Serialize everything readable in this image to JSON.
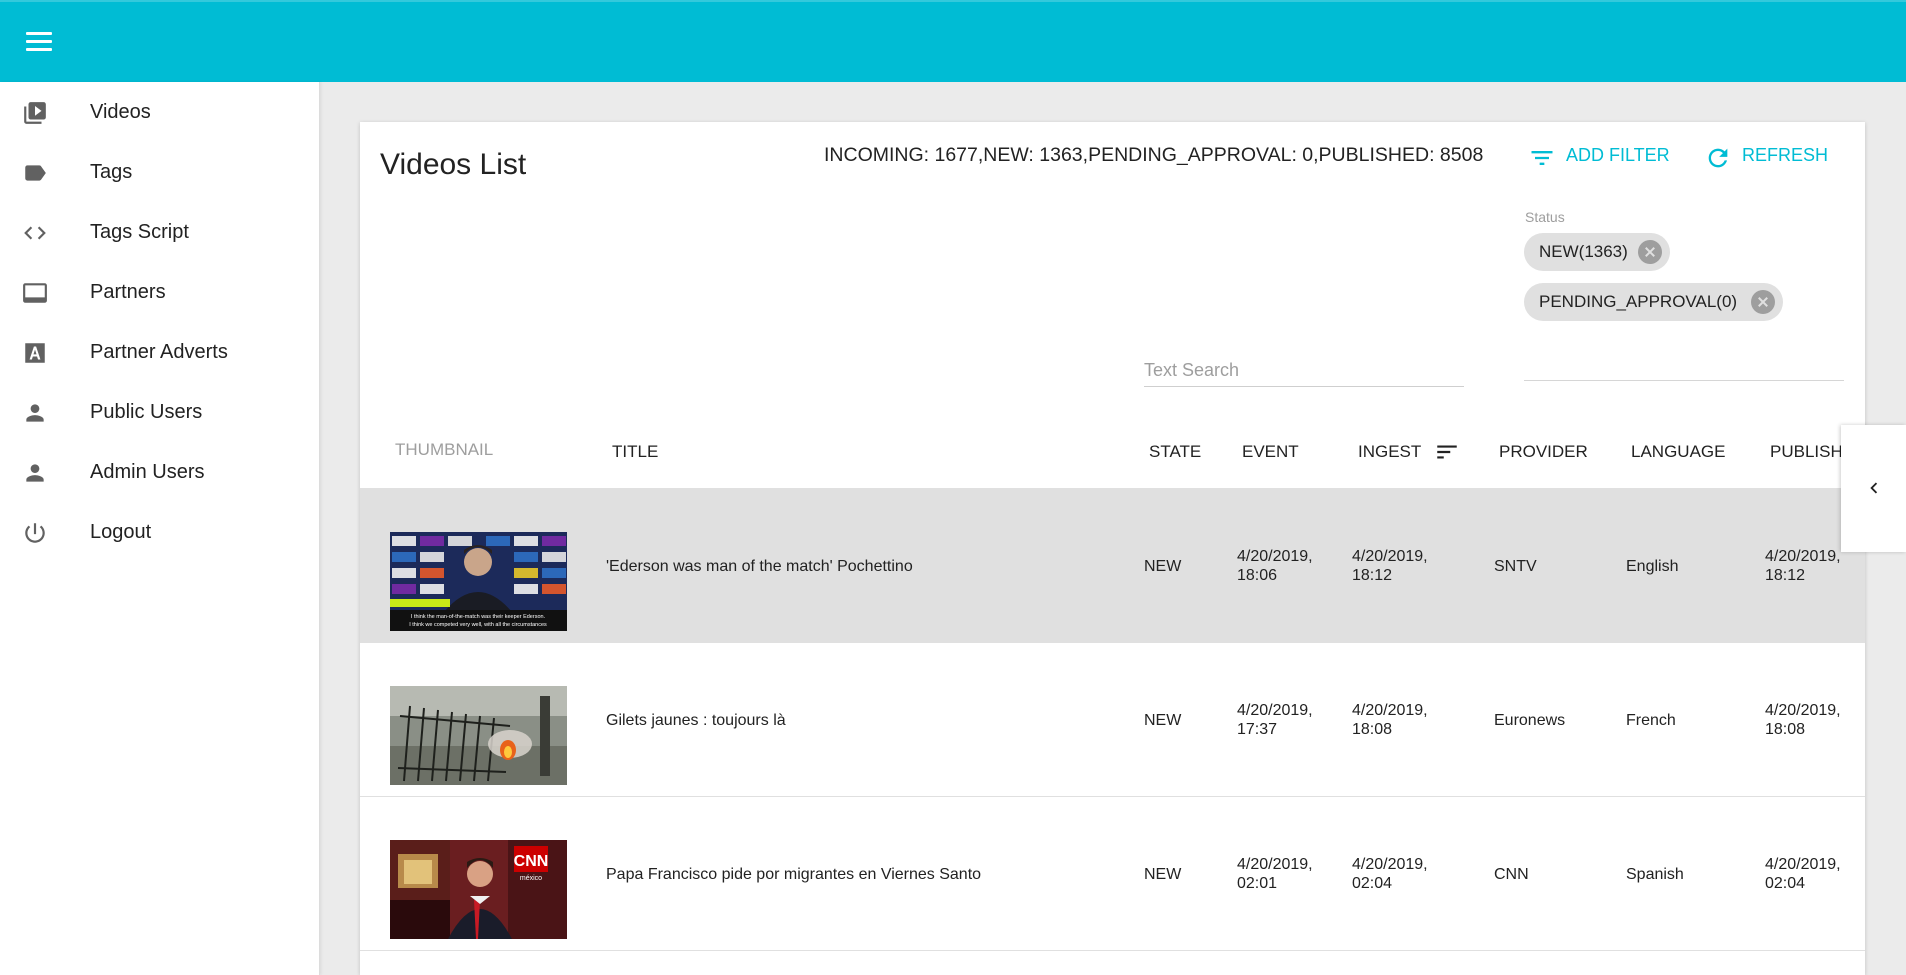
{
  "sidebar": {
    "items": [
      {
        "label": "Videos",
        "icon": "video-library-icon"
      },
      {
        "label": "Tags",
        "icon": "tag-icon"
      },
      {
        "label": "Tags Script",
        "icon": "code-icon"
      },
      {
        "label": "Partners",
        "icon": "monitor-icon"
      },
      {
        "label": "Partner Adverts",
        "icon": "letter-a-icon"
      },
      {
        "label": "Public Users",
        "icon": "person-icon"
      },
      {
        "label": "Admin Users",
        "icon": "person-icon"
      },
      {
        "label": "Logout",
        "icon": "power-icon"
      }
    ]
  },
  "main": {
    "title": "Videos List",
    "counts": "INCOMING: 1677,NEW: 1363,PENDING_APPROVAL: 0,PUBLISHED: 8508",
    "add_filter": "ADD FILTER",
    "refresh": "REFRESH",
    "status_label": "Status",
    "chips": [
      "NEW(1363)",
      "PENDING_APPROVAL(0)"
    ],
    "search_placeholder": "Text Search"
  },
  "table": {
    "headers": {
      "thumbnail": "THUMBNAIL",
      "title": "TITLE",
      "state": "STATE",
      "event": "EVENT",
      "ingest": "INGEST",
      "provider": "PROVIDER",
      "language": "LANGUAGE",
      "publish": "PUBLISH"
    },
    "sorted_column": "ingest",
    "rows": [
      {
        "title": "'Ederson was man of the match' Pochettino",
        "state": "NEW",
        "event_date": "4/20/2019,",
        "event_time": "18:06",
        "ingest_date": "4/20/2019,",
        "ingest_time": "18:12",
        "provider": "SNTV",
        "language": "English",
        "publish_date": "4/20/2019,",
        "publish_time": "18:12",
        "selected": true,
        "thumbnail": "press-conference"
      },
      {
        "title": "Gilets jaunes : toujours là",
        "state": "NEW",
        "event_date": "4/20/2019,",
        "event_time": "17:37",
        "ingest_date": "4/20/2019,",
        "ingest_time": "18:08",
        "provider": "Euronews",
        "language": "French",
        "publish_date": "4/20/2019,",
        "publish_time": "18:08",
        "selected": false,
        "thumbnail": "street-fire"
      },
      {
        "title": "Papa Francisco pide por migrantes en Viernes Santo",
        "state": "NEW",
        "event_date": "4/20/2019,",
        "event_time": "02:01",
        "ingest_date": "4/20/2019,",
        "ingest_time": "02:04",
        "provider": "CNN",
        "language": "Spanish",
        "publish_date": "4/20/2019,",
        "publish_time": "02:04",
        "selected": false,
        "thumbnail": "news-anchor"
      }
    ]
  },
  "thumb_caption": [
    "I think the man-of-the-match was their keeper Ederson.",
    "I think we competed very well, with all the circumstances"
  ],
  "cnn_logo": "CNN",
  "cnn_sub": "méxico",
  "colors": {
    "accent": "#00bcd4",
    "selected_row": "#e0e0e0",
    "chip": "#e0e0e0"
  }
}
